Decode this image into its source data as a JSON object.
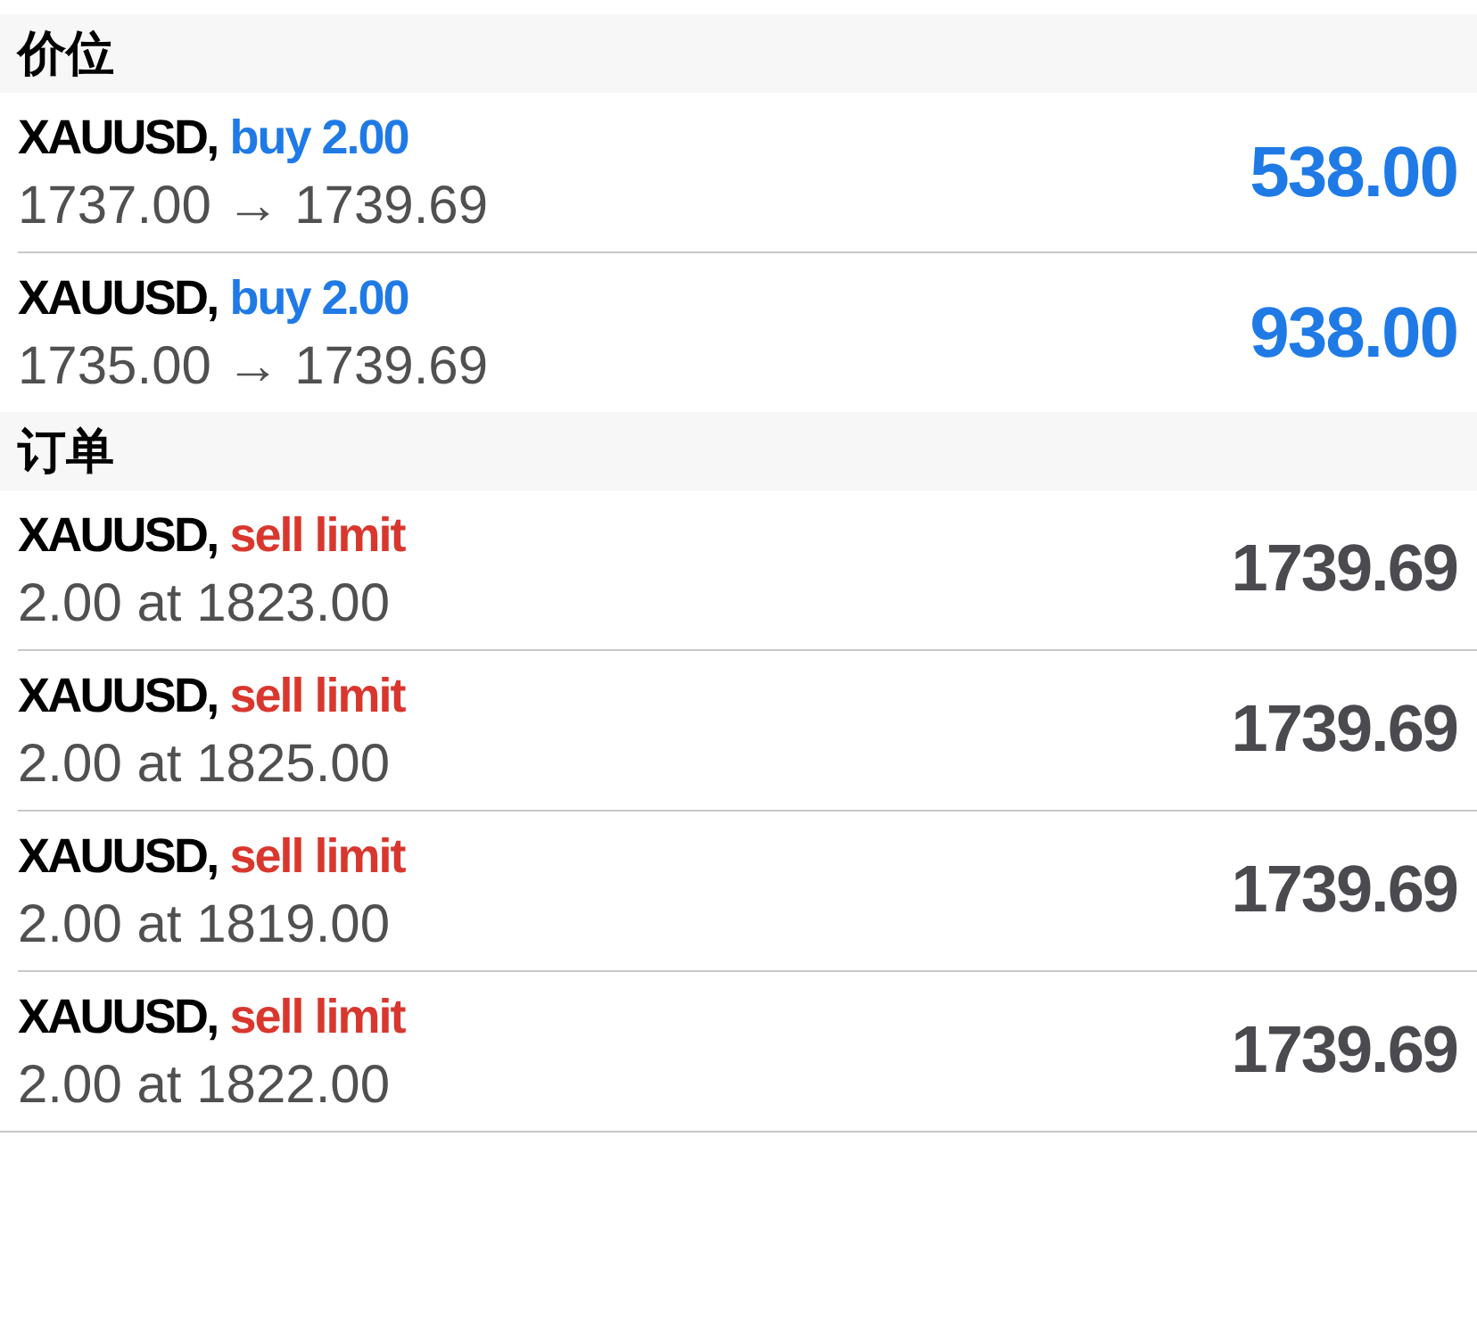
{
  "sections": [
    {
      "kind": "positions",
      "title": "价位",
      "items": [
        {
          "kind": "buy",
          "symbol": "XAUUSD,",
          "type": "buy 2.00",
          "detail": "1737.00 → 1739.69",
          "value": "538.00"
        },
        {
          "kind": "buy",
          "symbol": "XAUUSD,",
          "type": "buy 2.00",
          "detail": "1735.00 → 1739.69",
          "value": "938.00"
        }
      ]
    },
    {
      "kind": "orders",
      "title": "订单",
      "items": [
        {
          "kind": "sell",
          "symbol": "XAUUSD,",
          "type": "sell limit",
          "detail": "2.00 at 1823.00",
          "value": "1739.69"
        },
        {
          "kind": "sell",
          "symbol": "XAUUSD,",
          "type": "sell limit",
          "detail": "2.00 at 1825.00",
          "value": "1739.69"
        },
        {
          "kind": "sell",
          "symbol": "XAUUSD,",
          "type": "sell limit",
          "detail": "2.00 at 1819.00",
          "value": "1739.69"
        },
        {
          "kind": "sell",
          "symbol": "XAUUSD,",
          "type": "sell limit",
          "detail": "2.00 at 1822.00",
          "value": "1739.69"
        }
      ]
    }
  ]
}
